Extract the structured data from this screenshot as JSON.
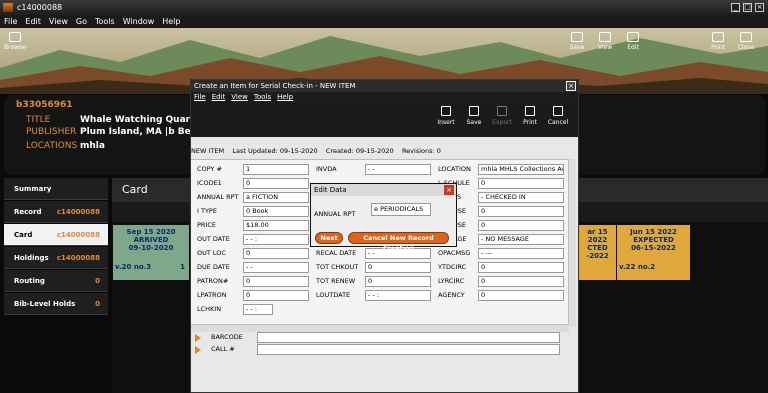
{
  "window": {
    "title": "c14000088"
  },
  "menu": [
    "File",
    "Edit",
    "View",
    "Go",
    "Tools",
    "Window",
    "Help"
  ],
  "toolbar": {
    "browse": "Browse",
    "save": "Save",
    "view": "View",
    "edit": "Edit",
    "print": "Print",
    "close": "Close"
  },
  "record": {
    "id": "b33056961",
    "title_label": "TITLE",
    "title": "Whale Watching Quarterly",
    "publisher_label": "PUBLISHER",
    "publisher": "Plum Island, MA |b Bell Roc",
    "locations_label": "LOCATIONS",
    "locations": "mhla"
  },
  "sidebar": [
    {
      "label": "Summary",
      "count": ""
    },
    {
      "label": "Record",
      "count": "c14000088"
    },
    {
      "label": "Card",
      "count": "c14000088"
    },
    {
      "label": "Holdings",
      "count": "c14000088"
    },
    {
      "label": "Routing",
      "count": "0"
    },
    {
      "label": "Bib-Level Holds",
      "count": "0"
    }
  ],
  "card": {
    "header": "Card",
    "box1": {
      "date": "Sep 15 2020",
      "status": "ARRIVED",
      "sub": "09-10-2020",
      "vol": "v.20 no.3",
      "n": "1"
    },
    "box2": {
      "date": "ar 15 2022",
      "status": "CTED",
      "sub": "-2022"
    },
    "box3": {
      "date": "Jun 15 2022",
      "status": "EXPECTED",
      "sub": "06-15-2022",
      "vol": "v.22 no.2"
    }
  },
  "dialog": {
    "title": "Create an Item for Serial Check-in - NEW ITEM",
    "menu": [
      "File",
      "Edit",
      "View",
      "Tools",
      "Help"
    ],
    "tools": [
      "Insert",
      "Save",
      "Export",
      "Print",
      "Cancel"
    ],
    "status": {
      "item": "NEW ITEM",
      "updated": "Last Updated: 09-15-2020",
      "created": "Created: 09-15-2020",
      "revisions": "Revisions: 0"
    },
    "col1": [
      [
        "COPY #",
        "1"
      ],
      [
        "ICODE1",
        "0"
      ],
      [
        "ANNUAL RPT",
        "a  FICTION"
      ],
      [
        "I TYPE",
        "0  Book"
      ],
      [
        "PRICE",
        "$18.00"
      ],
      [
        "OUT DATE",
        " -  -       :"
      ],
      [
        "OUT LOC",
        "0"
      ],
      [
        "DUE DATE",
        " -  -"
      ],
      [
        "PATRON#",
        "0"
      ],
      [
        "LPATRON",
        "0"
      ],
      [
        "LCHKIN",
        " -  -       :"
      ]
    ],
    "col2": [
      [
        "INVDA",
        " -  -"
      ],
      [
        "",
        ""
      ],
      [
        "",
        ""
      ],
      [
        "",
        ""
      ],
      [
        "",
        ""
      ],
      [
        "",
        ""
      ],
      [
        "RECAL DATE",
        " -  -"
      ],
      [
        "TOT CHKOUT",
        "0"
      ],
      [
        "TOT RENEW",
        "0"
      ],
      [
        "LOUTDATE",
        " -  -       :"
      ]
    ],
    "col3": [
      [
        "LOCATION",
        "mhla   MHLS Collections Av"
      ],
      [
        "L SCHULE",
        "0"
      ],
      [
        "S",
        "-  CHECKED IN"
      ],
      [
        "USE",
        "0"
      ],
      [
        "USE",
        "0"
      ],
      [
        "AGE",
        "-  NO MESSAGE"
      ],
      [
        "OPACMSG",
        "-  ---"
      ],
      [
        "YTDCIRC",
        "0"
      ],
      [
        "LYRCIRC",
        "0"
      ],
      [
        "AGENCY",
        "0"
      ]
    ],
    "barcode_label": "BARCODE",
    "callno_label": "CALL #"
  },
  "edit": {
    "title": "Edit Data",
    "field_label": "ANNUAL RPT",
    "field_value": "e  PERIODICALS",
    "next": "Next",
    "cancel": "Cancel New Record Creation"
  }
}
